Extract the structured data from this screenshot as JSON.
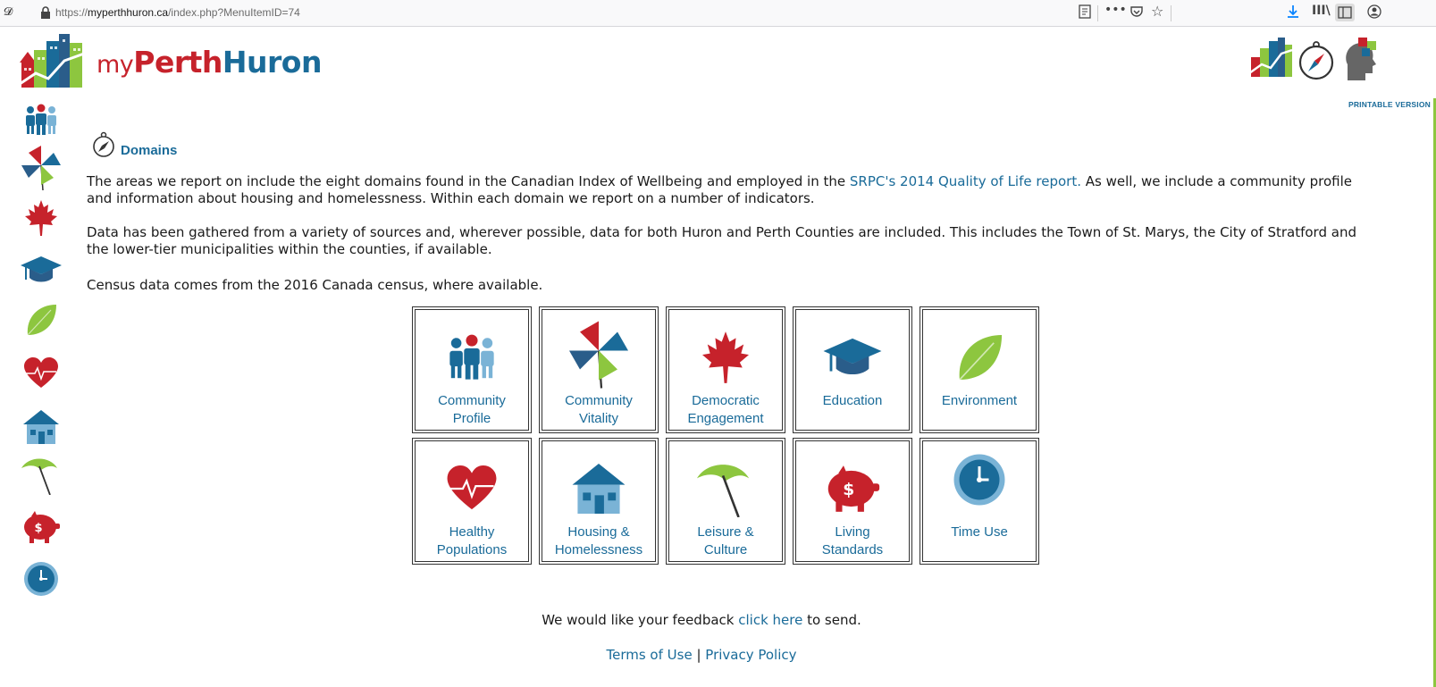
{
  "browser": {
    "url_prefix": "https://",
    "url_domain": "myperthhuron.ca",
    "url_path": "/index.php?MenuItemID=74"
  },
  "site": {
    "logo_my": "my",
    "logo_perth": "Perth",
    "logo_huron": "Huron",
    "printable": "PRINTABLE VERSION"
  },
  "heading": "Domains",
  "paragraphs": {
    "p1_a": "The areas we report on include the eight domains found in the Canadian Index of Wellbeing and employed in the ",
    "p1_link": "SRPC's 2014 Quality of Life report.",
    "p1_b": " As well, we include a community profile and information about housing and homelessness. Within each domain we report on a number of indicators.",
    "p2": "Data has been gathered from a variety of sources and, wherever possible, data for both Huron and Perth Counties are included. This includes the Town of St. Marys, the City of Stratford and the lower-tier municipalities within the counties, if available.",
    "p3": "Census data comes from the 2016 Canada census, where available."
  },
  "tiles": [
    {
      "line1": "Community",
      "line2": "Profile",
      "icon": "people-icon"
    },
    {
      "line1": "Community",
      "line2": "Vitality",
      "icon": "pinwheel-icon"
    },
    {
      "line1": "Democratic",
      "line2": "Engagement",
      "icon": "maple-leaf-icon"
    },
    {
      "line1": "Education",
      "line2": "",
      "icon": "graduation-cap-icon"
    },
    {
      "line1": "Environment",
      "line2": "",
      "icon": "leaf-icon"
    },
    {
      "line1": "Healthy",
      "line2": "Populations",
      "icon": "heart-icon"
    },
    {
      "line1": "Housing &",
      "line2": "Homelessness",
      "icon": "house-icon"
    },
    {
      "line1": "Leisure &",
      "line2": "Culture",
      "icon": "umbrella-icon"
    },
    {
      "line1": "Living",
      "line2": "Standards",
      "icon": "piggy-bank-icon"
    },
    {
      "line1": "Time Use",
      "line2": "",
      "icon": "clock-icon"
    }
  ],
  "footer": {
    "feedback_a": "We would like your feedback ",
    "feedback_link": "click here",
    "feedback_b": " to send.",
    "terms": "Terms of Use",
    "sep": " | ",
    "privacy": "Privacy Policy"
  },
  "colors": {
    "blue": "#1a6b99",
    "red": "#c6222b",
    "green": "#8dc63f"
  }
}
